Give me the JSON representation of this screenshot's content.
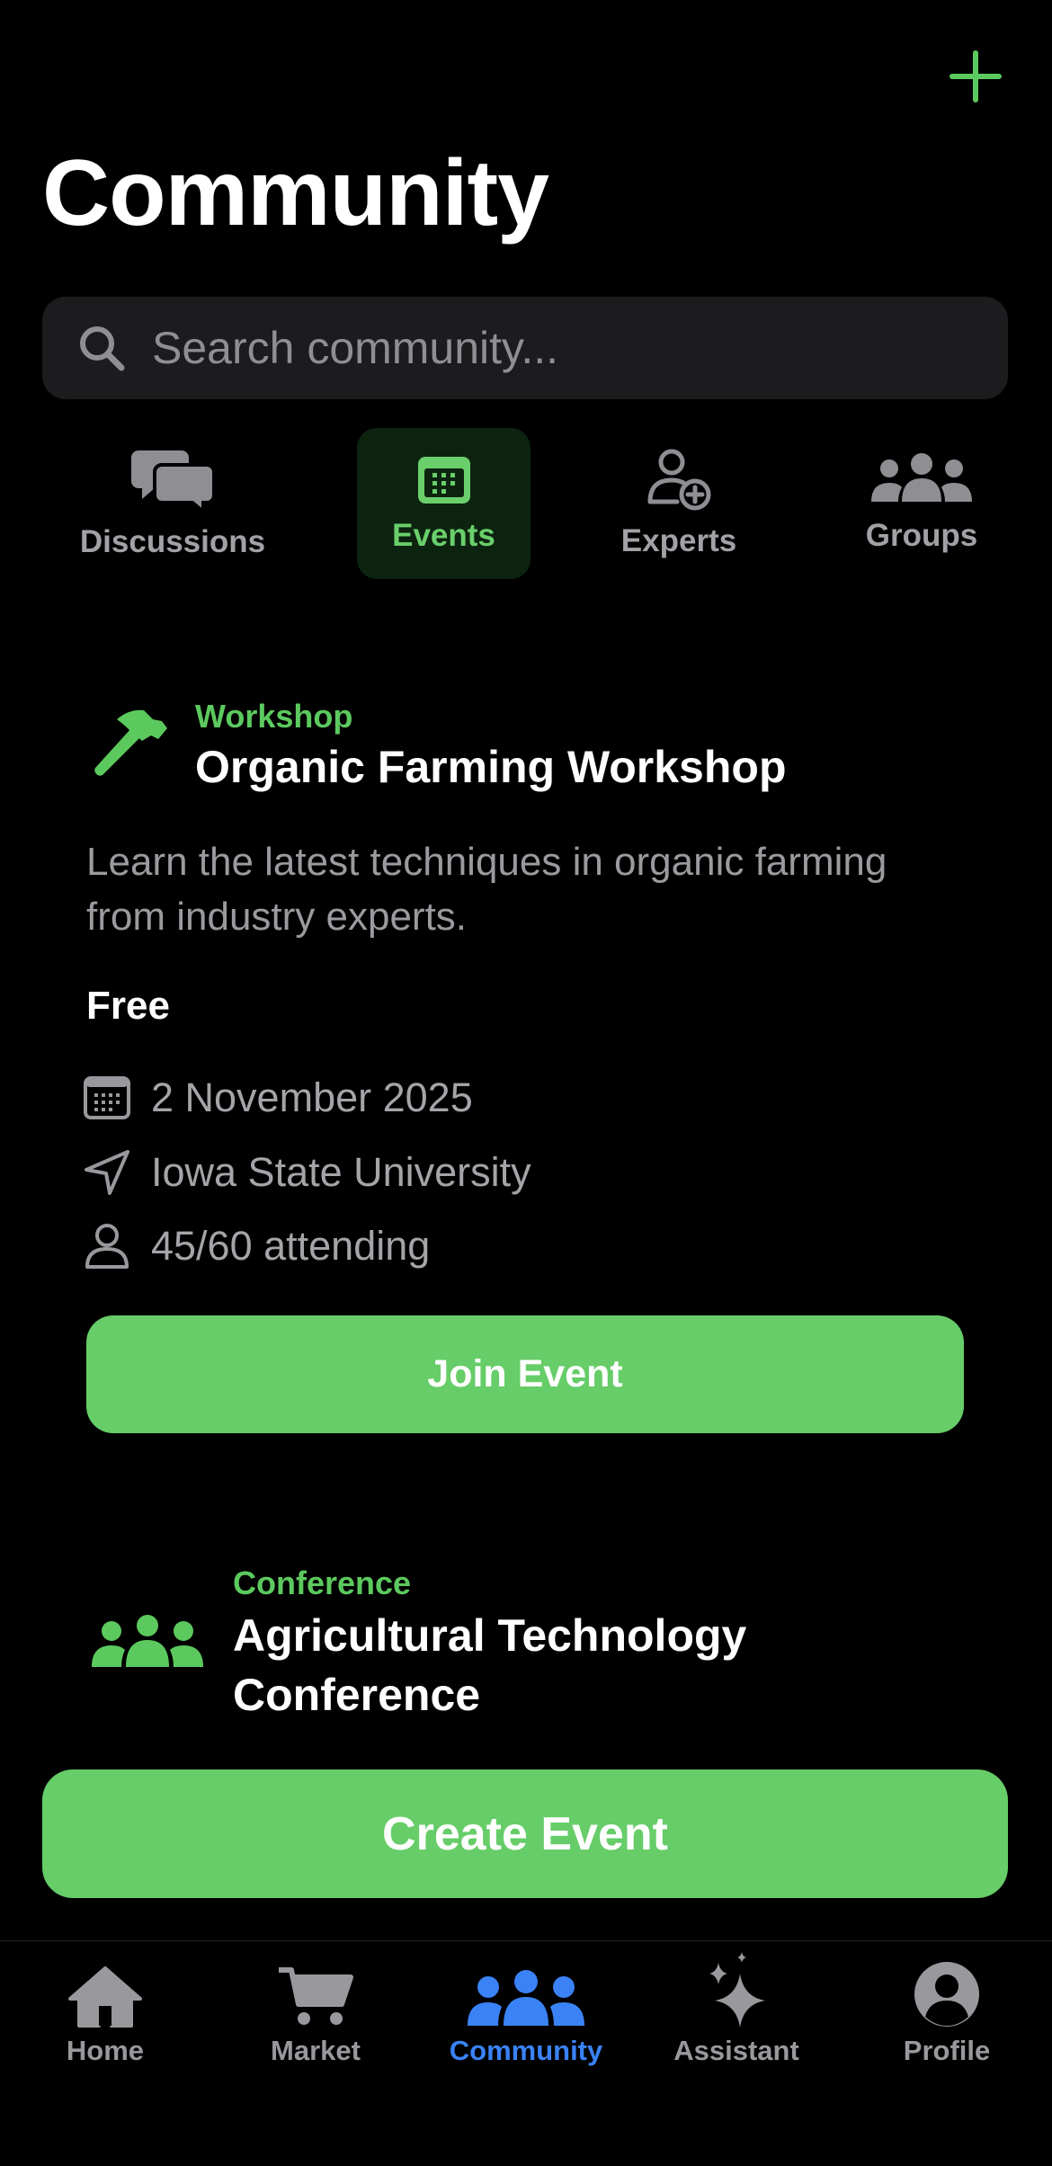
{
  "header": {
    "title": "Community",
    "add_icon": "plus-icon"
  },
  "search": {
    "placeholder": "Search community..."
  },
  "segments": [
    {
      "label": "Discussions",
      "icon": "chat-bubbles-icon",
      "active": false
    },
    {
      "label": "Events",
      "icon": "calendar-icon",
      "active": true
    },
    {
      "label": "Experts",
      "icon": "person-add-icon",
      "active": false
    },
    {
      "label": "Groups",
      "icon": "people-group-icon",
      "active": false
    }
  ],
  "events": [
    {
      "type": "Workshop",
      "icon": "hammer-icon",
      "title": "Organic Farming Workshop",
      "description": "Learn the latest techniques in organic farming from industry experts.",
      "price": "Free",
      "date": "2 November 2025",
      "location": "Iowa State University",
      "attendance": "45/60 attending",
      "action": "Join Event"
    },
    {
      "type": "Conference",
      "icon": "people-group-icon",
      "title_line1": "Agricultural Technology",
      "title_line2": "Conference"
    }
  ],
  "create_button": "Create Event",
  "tabbar": [
    {
      "label": "Home",
      "icon": "house-icon",
      "active": false
    },
    {
      "label": "Market",
      "icon": "cart-icon",
      "active": false
    },
    {
      "label": "Community",
      "icon": "people-group-icon",
      "active": true
    },
    {
      "label": "Assistant",
      "icon": "sparkles-icon",
      "active": false
    },
    {
      "label": "Profile",
      "icon": "person-circle-icon",
      "active": false
    }
  ],
  "colors": {
    "accent_green": "#66cd69",
    "accent_blue": "#3a82f6",
    "muted": "#98989d",
    "background": "#000000"
  }
}
